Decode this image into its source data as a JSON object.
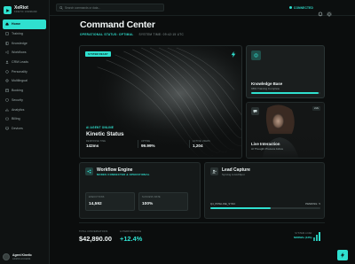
{
  "brand": {
    "name": "XeRiot",
    "subtitle": "KINETIC COMMAND"
  },
  "sidebar": {
    "items": [
      {
        "label": "Home",
        "icon": "home-icon",
        "active": true
      },
      {
        "label": "Training",
        "icon": "training-icon"
      },
      {
        "label": "Knowledge",
        "icon": "knowledge-icon"
      },
      {
        "label": "Workflows",
        "icon": "workflow-icon"
      },
      {
        "label": "CRM Leads",
        "icon": "crm-icon"
      },
      {
        "label": "Personality",
        "icon": "personality-icon"
      },
      {
        "label": "Multilingual",
        "icon": "multilingual-icon"
      },
      {
        "label": "Booking",
        "icon": "booking-icon"
      },
      {
        "label": "Security",
        "icon": "security-icon"
      },
      {
        "label": "Analytics",
        "icon": "analytics-icon"
      },
      {
        "label": "Billing",
        "icon": "billing-icon"
      },
      {
        "label": "Devices",
        "icon": "devices-icon"
      }
    ]
  },
  "user": {
    "name": "Agent Kinetic",
    "role": "ADMIN ACCESS"
  },
  "topbar": {
    "search_placeholder": "Search commands or data...",
    "connection": "CONNECTED"
  },
  "header": {
    "title": "Command Center",
    "operational_status": "OPERATIONAL STATUS: OPTIMAL",
    "system_time": "SYSTEM TIME: 09:42:15 UTC"
  },
  "hero": {
    "badge": "SYSTEM READY",
    "label": "AI AGENT ONLINE",
    "title": "Kinetic Status",
    "stats": [
      {
        "label": "RESPONSE TIME",
        "value": "142ms"
      },
      {
        "label": "UPTIME",
        "value": "99.99%"
      },
      {
        "label": "ACTIVE USERS",
        "value": "1,204"
      }
    ]
  },
  "knowledge": {
    "title": "Knowledge Base",
    "subtitle": "98% Training Complete",
    "progress": 0.98
  },
  "live": {
    "badge": "LIVE",
    "title": "Live Interaction",
    "subtitle": "AI Thought Process Active"
  },
  "workflow": {
    "title": "Workflow Engine",
    "subtitle": "NODES CONNECTED & OPERATIONAL",
    "stats": [
      {
        "label": "EXECUTIONS",
        "value": "14,592"
      },
      {
        "label": "SUCCESS RATE",
        "value": "100%"
      }
    ]
  },
  "leads": {
    "title": "Lead Capture",
    "subtitle": "Syncing to HubSpot",
    "queue_label": "Q4_PIPELINE_SYNC",
    "queue_status": "PENDING: 5",
    "progress": 0.55
  },
  "footer": {
    "conversations_label": "TOTAL CONVERSATIONS",
    "conversations_value": "$42,890.00",
    "performance_label": "AI PERFORMANCE",
    "performance_value": "+12.4%",
    "system_load_label": "SYSTEM LOAD",
    "system_load_value": "NORMAL (12%)",
    "load_bars": [
      0.45,
      0.7,
      1.0
    ]
  },
  "colors": {
    "accent": "#2fe0cf",
    "background": "#0b0d0d",
    "card": "#151919"
  }
}
